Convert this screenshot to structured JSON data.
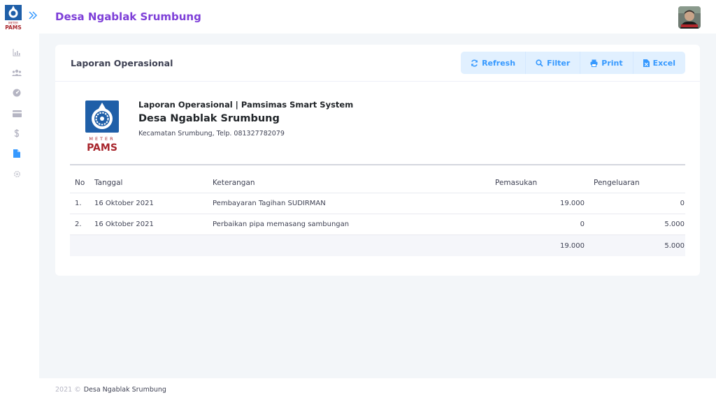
{
  "app": {
    "logo_word_top": "METER",
    "logo_word_bottom": "PAMS",
    "title": "Desa Ngablak Srumbung"
  },
  "sidebar": {
    "items": [
      {
        "icon": "chart-icon",
        "active": false
      },
      {
        "icon": "users-icon",
        "active": false
      },
      {
        "icon": "gauge-icon",
        "active": false
      },
      {
        "icon": "card-icon",
        "active": false
      },
      {
        "icon": "dollar-icon",
        "active": false
      },
      {
        "icon": "file-icon",
        "active": true
      },
      {
        "icon": "gear-icon",
        "active": false
      }
    ]
  },
  "card": {
    "title": "Laporan Operasional",
    "buttons": {
      "refresh": "Refresh",
      "filter": "Filter",
      "print": "Print",
      "excel": "Excel"
    }
  },
  "report": {
    "subtitle": "Laporan Operasional | Pamsimas Smart System",
    "name": "Desa Ngablak Srumbung",
    "address": "Kecamatan Srumbung, Telp. 081327782079",
    "columns": {
      "no": "No",
      "tanggal": "Tanggal",
      "keterangan": "Keterangan",
      "pemasukan": "Pemasukan",
      "pengeluaran": "Pengeluaran"
    },
    "rows": [
      {
        "no": "1.",
        "tanggal": "16 Oktober 2021",
        "keterangan": "Pembayaran Tagihan SUDIRMAN",
        "pemasukan": "19.000",
        "pengeluaran": "0"
      },
      {
        "no": "2.",
        "tanggal": "16 Oktober 2021",
        "keterangan": "Perbaikan pipa memasang sambungan",
        "pemasukan": "0",
        "pengeluaran": "5.000"
      }
    ],
    "totals": {
      "pemasukan": "19.000",
      "pengeluaran": "5.000"
    }
  },
  "footer": {
    "year": "2021 ©",
    "org": "Desa Ngablak Srumbung"
  },
  "colors": {
    "accent": "#7e3fd8",
    "button_bg": "#e1f0ff",
    "button_text": "#3699ff",
    "logo_blue": "#1f5fa8",
    "logo_red": "#a8252c",
    "page_bg": "#f3f6f9"
  }
}
